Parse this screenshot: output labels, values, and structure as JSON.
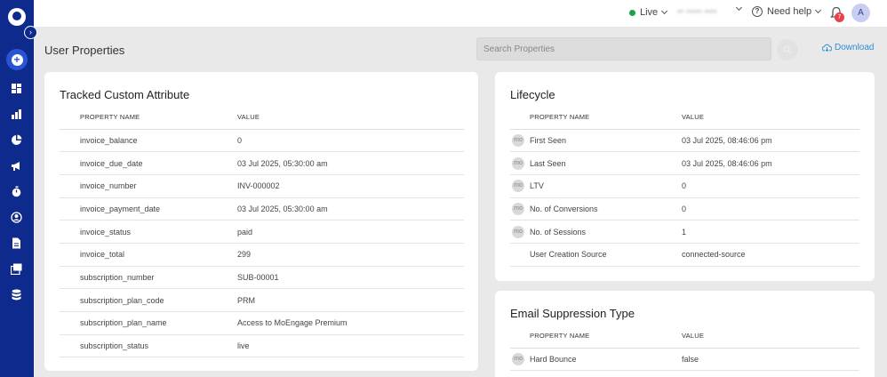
{
  "sidebar": {
    "expand_icon": "chevron-right-icon",
    "items": [
      {
        "name": "dashboard",
        "icon": "dashboard-icon"
      },
      {
        "name": "analyze",
        "icon": "bar-chart-icon"
      },
      {
        "name": "segment",
        "icon": "pie-chart-icon"
      },
      {
        "name": "engage",
        "icon": "megaphone-icon"
      },
      {
        "name": "flows",
        "icon": "stopwatch-icon"
      },
      {
        "name": "personalize",
        "icon": "user-circle-icon"
      },
      {
        "name": "content",
        "icon": "document-icon"
      },
      {
        "name": "templates",
        "icon": "gallery-icon"
      },
      {
        "name": "data",
        "icon": "database-icon"
      }
    ]
  },
  "topbar": {
    "environment": "Live",
    "workspace": "▪▪ ▪▪▪▪▪ ▪▪▪▪",
    "help": "Need help",
    "notification_count": "7",
    "avatar_initial": "A"
  },
  "page": {
    "title": "User Properties",
    "search_placeholder": "Search Properties",
    "download_label": "Download"
  },
  "tracked": {
    "title": "Tracked Custom Attribute",
    "columns": [
      "PROPERTY NAME",
      "VALUE"
    ],
    "rows": [
      {
        "name": "invoice_balance",
        "value": "0"
      },
      {
        "name": "invoice_due_date",
        "value": "03 Jul 2025, 05:30:00 am"
      },
      {
        "name": "invoice_number",
        "value": "INV-000002"
      },
      {
        "name": "invoice_payment_date",
        "value": "03 Jul 2025, 05:30:00 am"
      },
      {
        "name": "invoice_status",
        "value": "paid"
      },
      {
        "name": "invoice_total",
        "value": "299"
      },
      {
        "name": "subscription_number",
        "value": "SUB-00001"
      },
      {
        "name": "subscription_plan_code",
        "value": "PRM"
      },
      {
        "name": "subscription_plan_name",
        "value": "Access to MoEngage Premium"
      },
      {
        "name": "subscription_status",
        "value": "live"
      }
    ]
  },
  "lifecycle": {
    "title": "Lifecycle",
    "columns": [
      "PROPERTY NAME",
      "VALUE"
    ],
    "rows": [
      {
        "badge": "mo",
        "name": "First Seen",
        "value": "03 Jul 2025, 08:46:06 pm"
      },
      {
        "badge": "mo",
        "name": "Last Seen",
        "value": "03 Jul 2025, 08:46:06 pm"
      },
      {
        "badge": "mo",
        "name": "LTV",
        "value": "0"
      },
      {
        "badge": "mo",
        "name": "No. of Conversions",
        "value": "0"
      },
      {
        "badge": "mo",
        "name": "No. of Sessions",
        "value": "1"
      },
      {
        "badge": "",
        "name": "User Creation Source",
        "value": "connected-source"
      }
    ]
  },
  "email_suppression": {
    "title": "Email Suppression Type",
    "columns": [
      "PROPERTY NAME",
      "VALUE"
    ],
    "rows": [
      {
        "badge": "mo",
        "name": "Hard Bounce",
        "value": "false"
      }
    ]
  },
  "colors": {
    "sidebar": "#0d2a8c",
    "accent": "#2a54d6",
    "live": "#1aa34a",
    "badge": "#e8414b",
    "link": "#2f8fd0"
  }
}
